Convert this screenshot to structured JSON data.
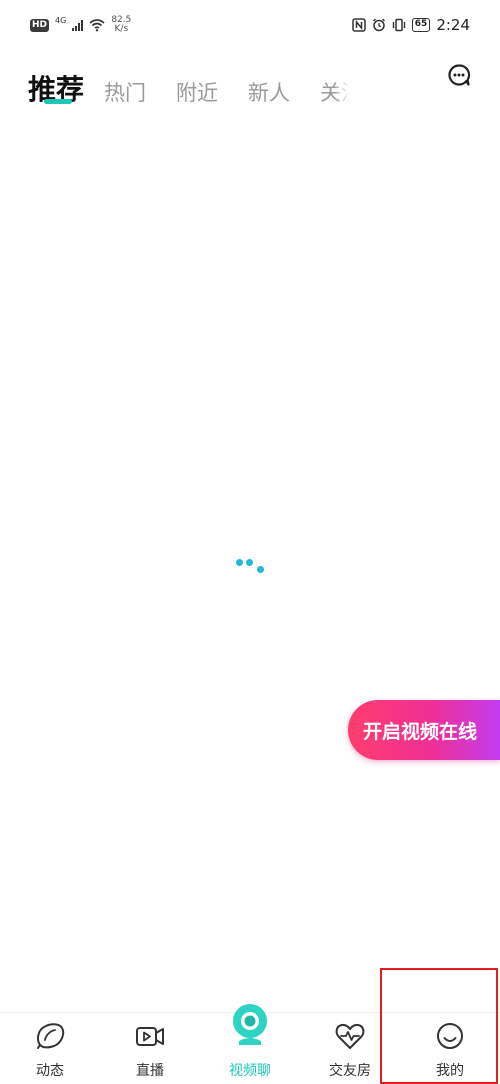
{
  "status_bar": {
    "hd": "HD",
    "network_gen": "4G",
    "speed_value": "82.5",
    "speed_unit": "K/s",
    "battery": "65",
    "time": "2:24"
  },
  "top_tabs": [
    {
      "label": "推荐",
      "active": true
    },
    {
      "label": "热门",
      "active": false
    },
    {
      "label": "附近",
      "active": false
    },
    {
      "label": "新人",
      "active": false
    },
    {
      "label": "关注",
      "active": false
    }
  ],
  "icons": {
    "message": "message-dots-icon",
    "loading": "loading-dots-icon"
  },
  "floating_button": {
    "label": "开启视频在线"
  },
  "bottom_nav": [
    {
      "label": "动态",
      "icon": "lemon-icon",
      "active": false
    },
    {
      "label": "直播",
      "icon": "video-play-icon",
      "active": false
    },
    {
      "label": "视频聊",
      "icon": "webcam-icon",
      "active": true
    },
    {
      "label": "交友房",
      "icon": "heart-pulse-icon",
      "active": false
    },
    {
      "label": "我的",
      "icon": "smile-face-icon",
      "active": false
    }
  ],
  "colors": {
    "accent": "#1fc6b8",
    "loader": "#25b6d6",
    "pill_start": "#ff3d6e",
    "pill_end": "#c23cf0",
    "highlight": "#e21e1e"
  }
}
